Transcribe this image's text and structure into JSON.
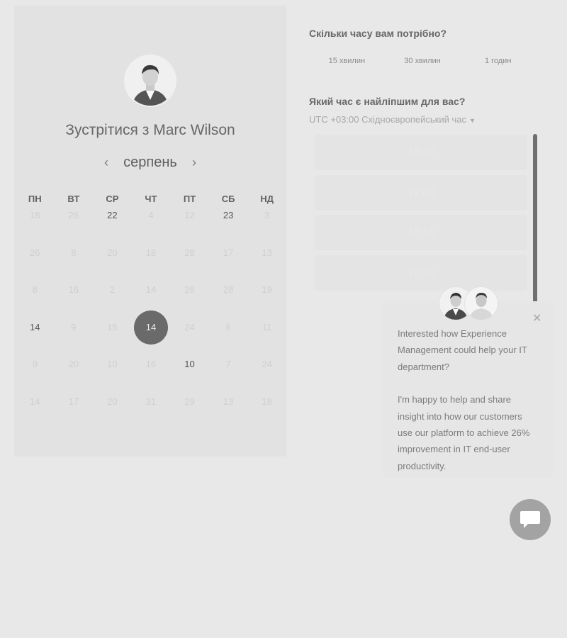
{
  "scheduler": {
    "title": "Зустрітися з Marc Wilson",
    "month": "серпень",
    "prev_icon": "chevron-left-icon",
    "next_icon": "chevron-right-icon",
    "weekdays": [
      "ПН",
      "ВТ",
      "СР",
      "ЧТ",
      "ПТ",
      "СБ",
      "НД"
    ],
    "weeks": [
      [
        "18",
        "26",
        "22",
        "4",
        "12",
        "23",
        "3"
      ],
      [
        "26",
        "8",
        "20",
        "18",
        "28",
        "17",
        "13"
      ],
      [
        "8",
        "16",
        "2",
        "14",
        "28",
        "28",
        "19"
      ],
      [
        "14",
        "9",
        "15",
        "14",
        "24",
        "6",
        "11"
      ],
      [
        "9",
        "20",
        "10",
        "16",
        "10",
        "7",
        "24"
      ],
      [
        "14",
        "17",
        "20",
        "31",
        "29",
        "13",
        "18"
      ]
    ]
  },
  "duration": {
    "question": "Скільки часу вам потрібно?",
    "options": [
      "15 хвилин",
      "30 хвилин",
      "1 годин"
    ]
  },
  "time": {
    "question": "Який час є найліпшим для вас?",
    "timezone": "UTC +03:00 Східноєвропейський час",
    "slots": [
      "16:45",
      "17:00",
      "17:15",
      "17:30"
    ]
  },
  "popup": {
    "line1": "Interested how Experience Management could help your IT department?",
    "line2": "I'm happy to help and share insight into how our customers use our platform to achieve 26% improvement in IT end-user productivity.",
    "close_icon": "close-icon"
  },
  "chat": {
    "icon": "chat-bubble-icon"
  }
}
